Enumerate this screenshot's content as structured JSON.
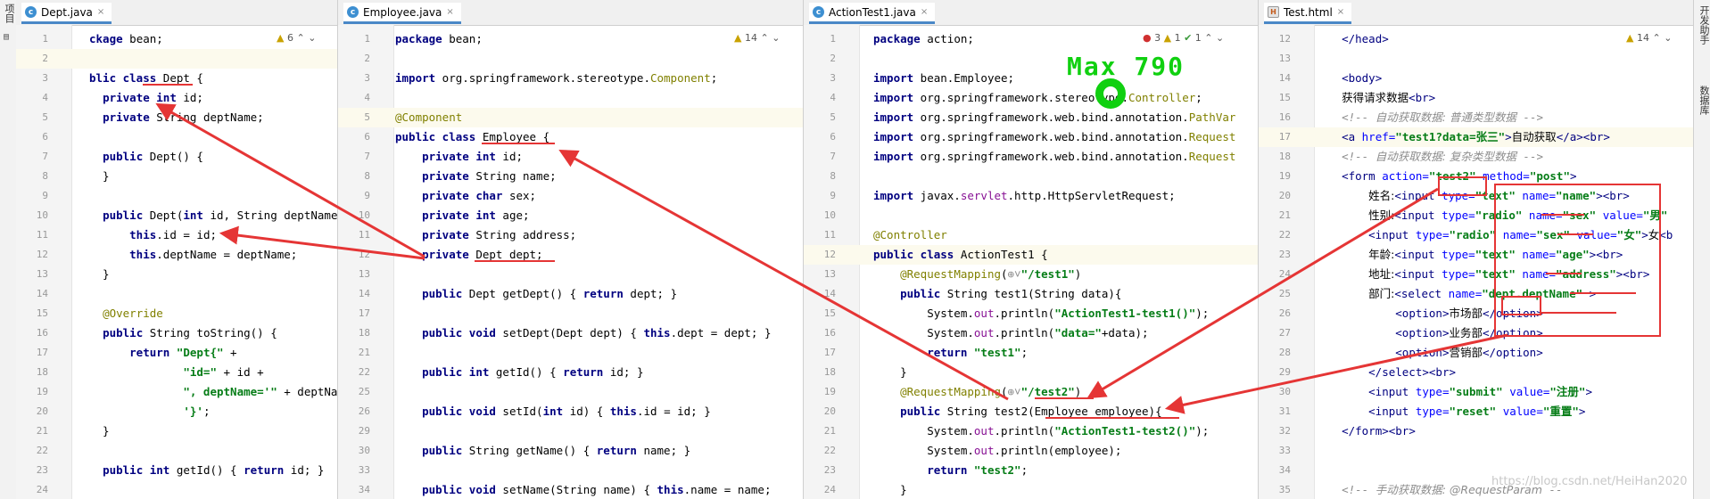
{
  "sidebar_left": {
    "project_label": "项目"
  },
  "sidebar_right": {
    "items": [
      "开发助手",
      "数据库"
    ]
  },
  "panes": [
    {
      "tab": {
        "title": "Dept.java",
        "icon": "c",
        "close": "×"
      },
      "inspect": {
        "warnings": "6",
        "warn_icon": "▲",
        "up": "⌃",
        "down": "⌄"
      },
      "lines": [
        {
          "n": "1",
          "h": "<span class=\"kw\">ckage</span> bean;"
        },
        {
          "n": "2",
          "h": "",
          "cur": true
        },
        {
          "n": "3",
          "h": "<span class=\"kw\">blic class</span> Dept {"
        },
        {
          "n": "4",
          "h": "  <span class=\"kw\">private int</span> id;"
        },
        {
          "n": "5",
          "h": "  <span class=\"kw\">private</span> String deptName;"
        },
        {
          "n": "6",
          "h": ""
        },
        {
          "n": "7",
          "h": "  <span class=\"kw\">public</span> Dept() {"
        },
        {
          "n": "8",
          "h": "  }"
        },
        {
          "n": "9",
          "h": ""
        },
        {
          "n": "10",
          "h": "  <span class=\"kw\">public</span> Dept(<span class=\"kw\">int</span> id, String deptName"
        },
        {
          "n": "11",
          "h": "      <span class=\"kw\">this</span>.id = id;"
        },
        {
          "n": "12",
          "h": "      <span class=\"kw\">this</span>.deptName = deptName;"
        },
        {
          "n": "13",
          "h": "  }"
        },
        {
          "n": "14",
          "h": ""
        },
        {
          "n": "15",
          "h": "  <span class=\"ann\">@Override</span>"
        },
        {
          "n": "16",
          "h": "  <span class=\"kw\">public</span> String toString() {"
        },
        {
          "n": "17",
          "h": "      <span class=\"kw\">return</span> <span class=\"str\">\"Dept{\"</span> +"
        },
        {
          "n": "18",
          "h": "              <span class=\"str\">\"id=\"</span> + id +"
        },
        {
          "n": "19",
          "h": "              <span class=\"str\">\", deptName='\"</span> + deptNa"
        },
        {
          "n": "20",
          "h": "              <span class=\"str\">'}'</span>;"
        },
        {
          "n": "21",
          "h": "  }"
        },
        {
          "n": "22",
          "h": ""
        },
        {
          "n": "23",
          "h": "  <span class=\"kw\">public int</span> getId() { <span class=\"kw\">return</span> id; }"
        },
        {
          "n": "24",
          "h": ""
        }
      ]
    },
    {
      "tab": {
        "title": "Employee.java",
        "icon": "c",
        "close": "×"
      },
      "inspect": {
        "warnings": "14",
        "warn_icon": "▲",
        "up": "⌃",
        "down": "⌄"
      },
      "lines": [
        {
          "n": "1",
          "h": "<span class=\"kw\">package</span> bean;"
        },
        {
          "n": "2",
          "h": ""
        },
        {
          "n": "3",
          "h": "<span class=\"kw\">import</span> org.springframework.stereotype.<span class=\"ann\">Component</span>;"
        },
        {
          "n": "4",
          "h": ""
        },
        {
          "n": "5",
          "h": "<span class=\"ann\">@Component</span>",
          "cur": true
        },
        {
          "n": "6",
          "h": "<span class=\"kw\">public class</span> Employee {"
        },
        {
          "n": "7",
          "h": "    <span class=\"kw\">private int</span> id;"
        },
        {
          "n": "8",
          "h": "    <span class=\"kw\">private</span> String name;"
        },
        {
          "n": "9",
          "h": "    <span class=\"kw\">private char</span> sex;"
        },
        {
          "n": "10",
          "h": "    <span class=\"kw\">private int</span> age;"
        },
        {
          "n": "11",
          "h": "    <span class=\"kw\">private</span> String address;"
        },
        {
          "n": "12",
          "h": "    <span class=\"kw\">private</span> Dept dept;"
        },
        {
          "n": "13",
          "h": ""
        },
        {
          "n": "14",
          "h": "    <span class=\"kw\">public</span> Dept getDept() { <span class=\"kw\">return</span> dept; }"
        },
        {
          "n": "17",
          "h": ""
        },
        {
          "n": "18",
          "h": "    <span class=\"kw\">public void</span> setDept(Dept dept) { <span class=\"kw\">this</span>.dept = dept; }"
        },
        {
          "n": "21",
          "h": ""
        },
        {
          "n": "22",
          "h": "    <span class=\"kw\">public int</span> getId() { <span class=\"kw\">return</span> id; }"
        },
        {
          "n": "25",
          "h": ""
        },
        {
          "n": "26",
          "h": "    <span class=\"kw\">public void</span> setId(<span class=\"kw\">int</span> id) { <span class=\"kw\">this</span>.id = id; }"
        },
        {
          "n": "29",
          "h": ""
        },
        {
          "n": "30",
          "h": "    <span class=\"kw\">public</span> String getName() { <span class=\"kw\">return</span> name; }"
        },
        {
          "n": "33",
          "h": ""
        },
        {
          "n": "34",
          "h": "    <span class=\"kw\">public void</span> setName(String name) { <span class=\"kw\">this</span>.name = name;"
        }
      ]
    },
    {
      "tab": {
        "title": "ActionTest1.java",
        "icon": "c",
        "close": "×"
      },
      "inspect": {
        "errors": "3",
        "warnings": "1",
        "ok": "1",
        "err_icon": "●",
        "warn_icon": "▲",
        "ok_icon": "✔",
        "up": "⌃",
        "down": "⌄"
      },
      "lines": [
        {
          "n": "1",
          "h": "<span class=\"kw\">package</span> action;"
        },
        {
          "n": "2",
          "h": ""
        },
        {
          "n": "3",
          "h": "<span class=\"kw\">import</span> bean.Employee;"
        },
        {
          "n": "4",
          "h": "<span class=\"kw\">import</span> org.springframework.stereotype.<span class=\"ann\">Controller</span>;"
        },
        {
          "n": "5",
          "h": "<span class=\"kw\">import</span> org.springframework.web.bind.annotation.<span class=\"ann\">PathVar</span>"
        },
        {
          "n": "6",
          "h": "<span class=\"kw\">import</span> org.springframework.web.bind.annotation.<span class=\"ann\">Request</span>"
        },
        {
          "n": "7",
          "h": "<span class=\"kw\">import</span> org.springframework.web.bind.annotation.<span class=\"ann\">Request</span>"
        },
        {
          "n": "8",
          "h": ""
        },
        {
          "n": "9",
          "h": "<span class=\"kw\">import</span> javax.<span class=\"pkg\">servlet</span>.http.HttpServletRequest;"
        },
        {
          "n": "10",
          "h": ""
        },
        {
          "n": "11",
          "h": "<span class=\"ann\">@Controller</span>"
        },
        {
          "n": "12",
          "h": "<span class=\"kw\">public class</span> ActionTest1 {",
          "cur": true
        },
        {
          "n": "13",
          "h": "    <span class=\"ann\">@RequestMapping</span>(<span class=\"cmt\">⊕˅</span><span class=\"str\">\"/test1\"</span>)"
        },
        {
          "n": "14",
          "h": "    <span class=\"kw\">public</span> String test1(String data){"
        },
        {
          "n": "15",
          "h": "        System.<span class=\"pkg\">out</span>.println(<span class=\"str\">\"ActionTest1-test1()\"</span>);"
        },
        {
          "n": "16",
          "h": "        System.<span class=\"pkg\">out</span>.println(<span class=\"str\">\"data=\"</span>+data);"
        },
        {
          "n": "17",
          "h": "        <span class=\"kw\">return</span> <span class=\"str\">\"test1\"</span>;"
        },
        {
          "n": "18",
          "h": "    }"
        },
        {
          "n": "19",
          "h": "    <span class=\"ann\">@RequestMapping</span>(<span class=\"cmt\">⊕˅</span><span class=\"str\">\"/test2\"</span>)"
        },
        {
          "n": "20",
          "h": "    <span class=\"kw\">public</span> String test2(Employee employee){"
        },
        {
          "n": "21",
          "h": "        System.<span class=\"pkg\">out</span>.println(<span class=\"str\">\"ActionTest1-test2()\"</span>);"
        },
        {
          "n": "22",
          "h": "        System.<span class=\"pkg\">out</span>.println(employee);"
        },
        {
          "n": "23",
          "h": "        <span class=\"kw\">return</span> <span class=\"str\">\"test2\"</span>;"
        },
        {
          "n": "24",
          "h": "    }"
        }
      ]
    },
    {
      "tab": {
        "title": "Test.html",
        "icon": "H",
        "close": "×"
      },
      "inspect": {
        "warnings": "14",
        "warn_icon": "▲",
        "up": "⌃",
        "down": "⌄"
      },
      "lines": [
        {
          "n": "12",
          "h": "  <span class=\"tag\">&lt;/head&gt;</span>"
        },
        {
          "n": "13",
          "h": ""
        },
        {
          "n": "14",
          "h": "  <span class=\"tag\">&lt;body&gt;</span>"
        },
        {
          "n": "15",
          "h": "  <span class=\"cyr\">获得请求数据</span><span class=\"tag\">&lt;br&gt;</span>"
        },
        {
          "n": "16",
          "h": "  <span class=\"cmt\">&lt;!-- <span class=\"cyr\">自动获取数据: 普通类型数据</span> --&gt;</span>"
        },
        {
          "n": "17",
          "h": "  <span class=\"tag\">&lt;a</span> <span class=\"attr\">href=</span><span class=\"str\">\"test1?data=张三\"</span><span class=\"tag\">&gt;</span><span class=\"cyr\">自动获取</span><span class=\"tag\">&lt;/a&gt;&lt;br&gt;</span>",
          "cur": true
        },
        {
          "n": "18",
          "h": "  <span class=\"cmt\">&lt;!-- <span class=\"cyr\">自动获取数据: 复杂类型数据</span> --&gt;</span>"
        },
        {
          "n": "19",
          "h": "  <span class=\"tag\">&lt;form</span> <span class=\"attr\">action=</span><span class=\"str\">\"test2\"</span> <span class=\"attr\">method=</span><span class=\"str\">\"post\"</span><span class=\"tag\">&gt;</span>"
        },
        {
          "n": "20",
          "h": "      <span class=\"cyr\">姓名:</span><span class=\"tag\">&lt;input</span> <span class=\"attr\">type=</span><span class=\"str\">\"text\"</span> <span class=\"attr\">name=</span><span class=\"str\">\"name\"</span><span class=\"tag\">&gt;&lt;br&gt;</span>"
        },
        {
          "n": "21",
          "h": "      <span class=\"cyr\">性别:</span><span class=\"tag\">&lt;input</span> <span class=\"attr\">type=</span><span class=\"str\">\"radio\"</span> <span class=\"attr\">name=</span><span class=\"str\">\"sex\"</span> <span class=\"attr\">value=</span><span class=\"str\">\"男\"</span>"
        },
        {
          "n": "22",
          "h": "      <span class=\"tag\">&lt;input</span> <span class=\"attr\">type=</span><span class=\"str\">\"radio\"</span> <span class=\"attr\">name=</span><span class=\"str\">\"sex\"</span> <span class=\"attr\">value=</span><span class=\"str\">\"女\"</span><span class=\"tag\">&gt;</span><span class=\"cyr\">女</span><span class=\"tag\">&lt;b</span>"
        },
        {
          "n": "23",
          "h": "      <span class=\"cyr\">年龄:</span><span class=\"tag\">&lt;input</span> <span class=\"attr\">type=</span><span class=\"str\">\"text\"</span> <span class=\"attr\">name=</span><span class=\"str\">\"age\"</span><span class=\"tag\">&gt;&lt;br&gt;</span>"
        },
        {
          "n": "24",
          "h": "      <span class=\"cyr\">地址:</span><span class=\"tag\">&lt;input</span> <span class=\"attr\">type=</span><span class=\"str\">\"text\"</span> <span class=\"attr\">name=</span><span class=\"str\">\"address\"</span><span class=\"tag\">&gt;&lt;br&gt;</span>"
        },
        {
          "n": "25",
          "h": "      <span class=\"cyr\">部门:</span><span class=\"tag\">&lt;select</span> <span class=\"attr\">name=</span><span class=\"str\">\"dept.deptName\"</span> <span class=\"tag\">&gt;</span>"
        },
        {
          "n": "26",
          "h": "          <span class=\"tag\">&lt;option&gt;</span><span class=\"cyr\">市场部</span><span class=\"tag\">&lt;/option&gt;</span>"
        },
        {
          "n": "27",
          "h": "          <span class=\"tag\">&lt;option&gt;</span><span class=\"cyr\">业务部</span><span class=\"tag\">&lt;/option&gt;</span>"
        },
        {
          "n": "28",
          "h": "          <span class=\"tag\">&lt;option&gt;</span><span class=\"cyr\">营销部</span><span class=\"tag\">&lt;/option&gt;</span>"
        },
        {
          "n": "29",
          "h": "      <span class=\"tag\">&lt;/select&gt;&lt;br&gt;</span>"
        },
        {
          "n": "30",
          "h": "      <span class=\"tag\">&lt;input</span> <span class=\"attr\">type=</span><span class=\"str\">\"submit\"</span> <span class=\"attr\">value=</span><span class=\"str\">\"注册\"</span><span class=\"tag\">&gt;</span>"
        },
        {
          "n": "31",
          "h": "      <span class=\"tag\">&lt;input</span> <span class=\"attr\">type=</span><span class=\"str\">\"reset\"</span> <span class=\"attr\">value=</span><span class=\"str\">\"重置\"</span><span class=\"tag\">&gt;</span>"
        },
        {
          "n": "32",
          "h": "  <span class=\"tag\">&lt;/form&gt;&lt;br&gt;</span>"
        },
        {
          "n": "33",
          "h": ""
        },
        {
          "n": "34",
          "h": ""
        },
        {
          "n": "35",
          "h": "  <span class=\"cmt\">&lt;!-- <span class=\"cyr\">手动获取数据: @RequestParam</span> --</span>"
        }
      ]
    }
  ],
  "overlay": {
    "hud_text": "Max 790",
    "watermark": "https://blog.csdn.net/HeiHan2020"
  },
  "colors": {
    "annotation_red": "#e53535",
    "hud_green": "#10d010",
    "tab_accent": "#4a88c7"
  }
}
